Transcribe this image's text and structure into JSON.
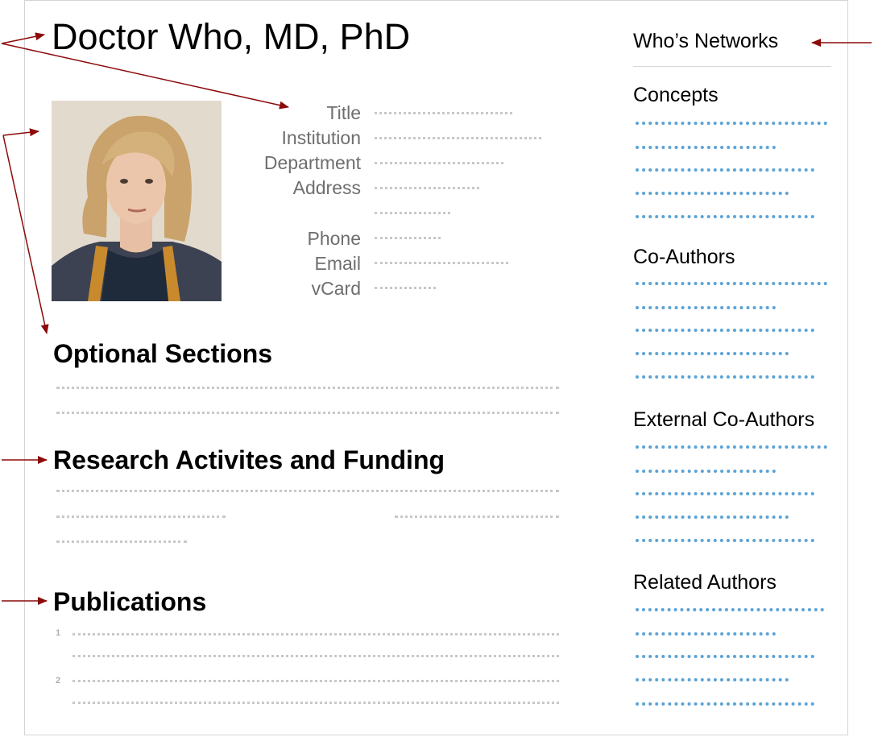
{
  "profile": {
    "name": "Doctor Who, MD, PhD",
    "labels": {
      "title": "Title",
      "institution": "Institution",
      "department": "Department",
      "address": "Address",
      "phone": "Phone",
      "email": "Email",
      "vcard": "vCard"
    }
  },
  "sections": {
    "optional": "Optional Sections",
    "research": "Research Activites and Funding",
    "publications": "Publications",
    "publication_numbers": [
      "1",
      "2"
    ]
  },
  "sidebar": {
    "networks_title": "Who’s Networks",
    "headings": [
      "Concepts",
      "Co-Authors",
      "External Co-Authors",
      "Related Authors"
    ]
  },
  "colors": {
    "arrow": "#8b0a0a",
    "placeholder_gray": "#c8c8c8",
    "placeholder_blue": "#5ba3d6"
  }
}
